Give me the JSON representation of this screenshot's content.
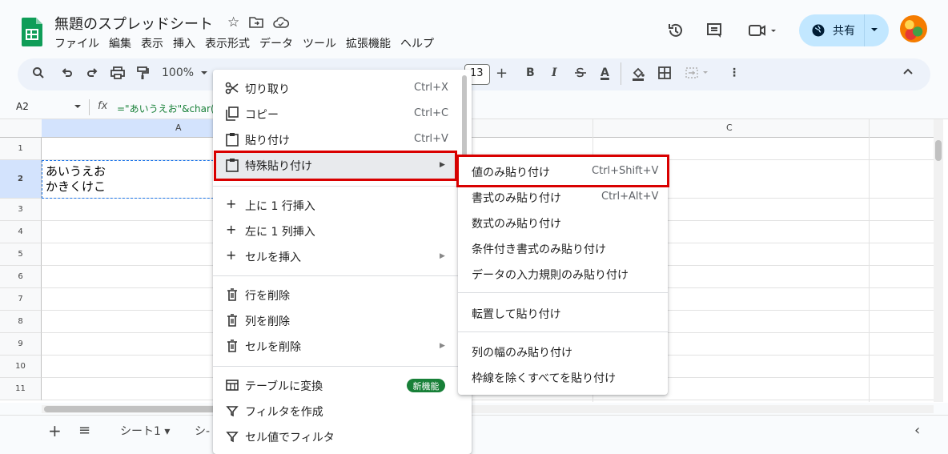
{
  "header": {
    "doc_title": "無題のスプレッドシート",
    "menu": [
      "ファイル",
      "編集",
      "表示",
      "挿入",
      "表示形式",
      "データ",
      "ツール",
      "拡張機能",
      "ヘルプ"
    ],
    "share_label": "共有"
  },
  "toolbar": {
    "zoom": "100%",
    "font_size": "13",
    "plus": "+",
    "bold": "B",
    "italic": "I",
    "font_color": "A",
    "more": "⋮"
  },
  "formula_bar": {
    "name_box": "A2",
    "fx": "fx",
    "formula": "=\"あいうえお\"&char("
  },
  "grid": {
    "columns": [
      "A",
      "C"
    ],
    "rows": [
      "1",
      "2",
      "3",
      "4",
      "5",
      "6",
      "7",
      "8",
      "9",
      "10",
      "11"
    ],
    "a2_value": "あいうえお\nかきくけこ"
  },
  "sheets": {
    "sheet1": "シート1 ▾",
    "sheet2": "シ-"
  },
  "context_menu": {
    "cut": {
      "label": "切り取り",
      "shortcut": "Ctrl+X"
    },
    "copy": {
      "label": "コピー",
      "shortcut": "Ctrl+C"
    },
    "paste": {
      "label": "貼り付け",
      "shortcut": "Ctrl+V"
    },
    "paste_special": {
      "label": "特殊貼り付け"
    },
    "insert_row_above": "上に 1 行挿入",
    "insert_col_left": "左に 1 列挿入",
    "insert_cells": "セルを挿入",
    "delete_row": "行を削除",
    "delete_col": "列を削除",
    "delete_cells": "セルを削除",
    "convert_table": "テーブルに変換",
    "new_badge": "新機能",
    "create_filter": "フィルタを作成",
    "filter_by_value": "セル値でフィルタ"
  },
  "submenu": {
    "values_only": {
      "label": "値のみ貼り付け",
      "shortcut": "Ctrl+Shift+V"
    },
    "format_only": {
      "label": "書式のみ貼り付け",
      "shortcut": "Ctrl+Alt+V"
    },
    "formula_only": "数式のみ貼り付け",
    "cond_format_only": "条件付き書式のみ貼り付け",
    "validation_only": "データの入力規則のみ貼り付け",
    "transpose": "転置して貼り付け",
    "col_width_only": "列の幅のみ貼り付け",
    "all_except_borders": "枠線を除くすべてを貼り付け"
  },
  "colors": {
    "highlight_border": "#d90000",
    "share_bg": "#c2e7ff",
    "sheets_green": "#0f9d58",
    "badge_green": "#188038"
  }
}
